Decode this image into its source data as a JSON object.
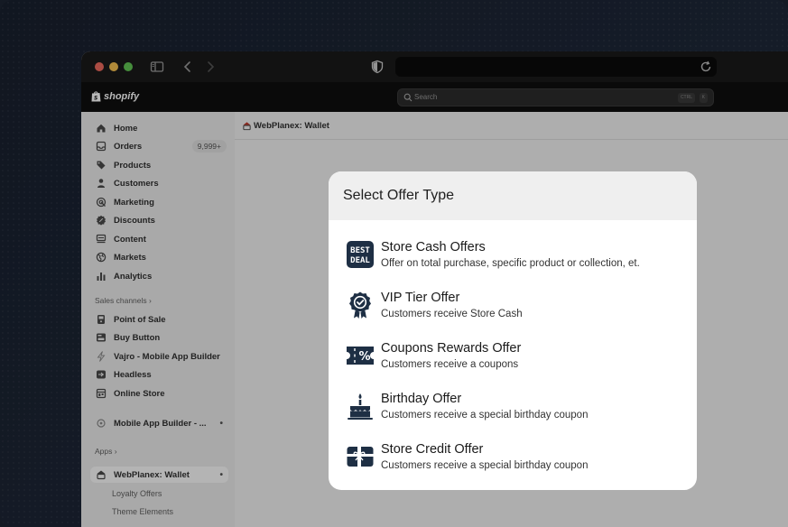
{
  "shopify": {
    "logo_text": "shopify"
  },
  "search": {
    "placeholder": "Search",
    "kbd_ctrl": "CTRL",
    "kbd_k": "K"
  },
  "sidebar": {
    "items": [
      {
        "label": "Home",
        "icon": "home-icon"
      },
      {
        "label": "Orders",
        "icon": "inbox-icon",
        "badge": "9,999+"
      },
      {
        "label": "Products",
        "icon": "tag-icon"
      },
      {
        "label": "Customers",
        "icon": "person-icon"
      },
      {
        "label": "Marketing",
        "icon": "target-icon"
      },
      {
        "label": "Discounts",
        "icon": "discount-icon"
      },
      {
        "label": "Content",
        "icon": "content-icon"
      },
      {
        "label": "Markets",
        "icon": "globe-icon"
      },
      {
        "label": "Analytics",
        "icon": "bar-chart-icon"
      }
    ],
    "sales_channels_label": "Sales channels",
    "channels": [
      {
        "label": "Point of Sale",
        "icon": "pos-icon"
      },
      {
        "label": "Buy Button",
        "icon": "buy-button-icon"
      },
      {
        "label": "Vajro - Mobile App Builder",
        "icon": "bolt-icon"
      },
      {
        "label": "Headless",
        "icon": "headless-icon"
      },
      {
        "label": "Online Store",
        "icon": "store-icon"
      }
    ],
    "pinned_app": "Mobile App Builder - ...",
    "apps_label": "Apps",
    "active_app": "WebPlanex: Wallet",
    "sub_items": [
      "Loyalty Offers",
      "Theme Elements"
    ]
  },
  "main": {
    "breadcrumb": "WebPlanex: Wallet"
  },
  "modal": {
    "title": "Select Offer Type",
    "offers": [
      {
        "title": "Store Cash Offers",
        "desc": "Offer on total purchase, specific  product or collection, et.",
        "icon": "best-deal-icon",
        "icon_text": [
          "BEST",
          "DEAL"
        ]
      },
      {
        "title": "VIP Tier Offer",
        "desc": "Customers receive Store Cash",
        "icon": "award-badge-icon"
      },
      {
        "title": "Coupons Rewards Offer",
        "desc": "Customers receive a coupons",
        "icon": "coupon-icon",
        "icon_text": [
          "%"
        ]
      },
      {
        "title": "Birthday Offer",
        "desc": "Customers receive a special birthday coupon",
        "icon": "birthday-cake-icon"
      },
      {
        "title": "Store Credit Offer",
        "desc": "Customers receive a special birthday coupon",
        "icon": "gift-card-icon"
      }
    ]
  }
}
